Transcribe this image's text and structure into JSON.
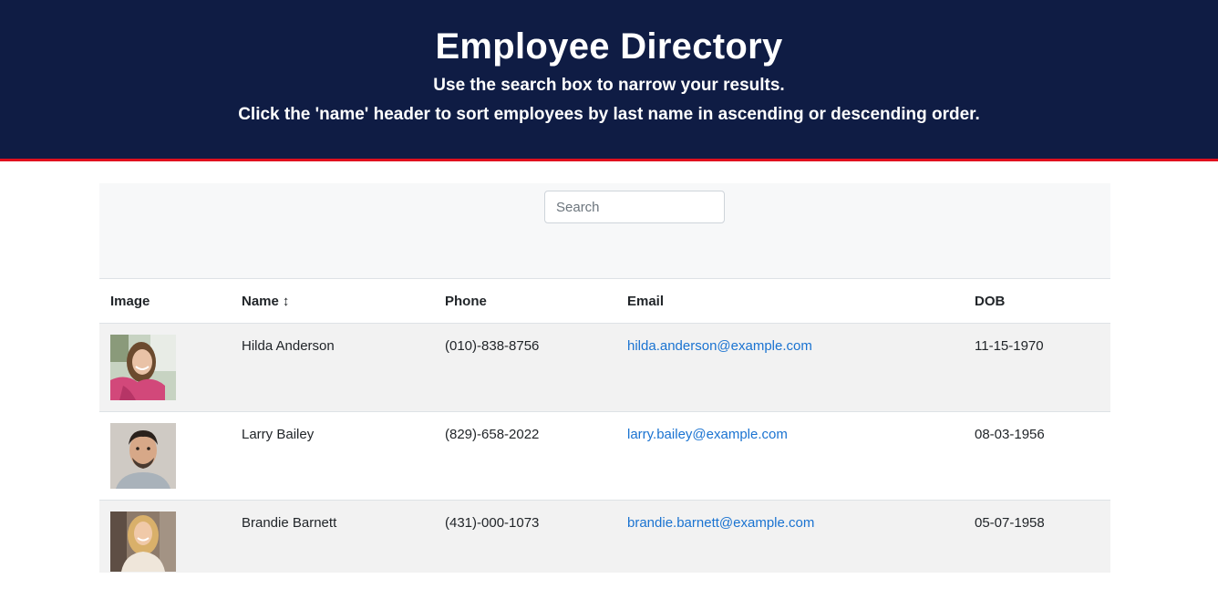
{
  "header": {
    "title": "Employee Directory",
    "subtitle_1": "Use the search box to narrow your results.",
    "subtitle_2": "Click the 'name' header to sort employees by last name in ascending or descending order."
  },
  "search": {
    "placeholder": "Search",
    "value": ""
  },
  "table": {
    "columns": {
      "image": "Image",
      "name": "Name",
      "name_sort_icon": "↕",
      "phone": "Phone",
      "email": "Email",
      "dob": "DOB"
    },
    "rows": [
      {
        "name": "Hilda Anderson",
        "phone": "(010)-838-8756",
        "email": "hilda.anderson@example.com",
        "dob": "11-15-1970",
        "avatar": "photo of a smiling woman in pink jacket"
      },
      {
        "name": "Larry Bailey",
        "phone": "(829)-658-2022",
        "email": "larry.bailey@example.com",
        "dob": "08-03-1956",
        "avatar": "photo of a smiling man with dark hair"
      },
      {
        "name": "Brandie Barnett",
        "phone": "(431)-000-1073",
        "email": "brandie.barnett@example.com",
        "dob": "05-07-1958",
        "avatar": "photo of a smiling blonde woman"
      }
    ]
  },
  "colors": {
    "header_bg": "#0f1c44",
    "header_border": "#e0101e",
    "link": "#1a73d1",
    "stripe": "#f2f2f2"
  }
}
